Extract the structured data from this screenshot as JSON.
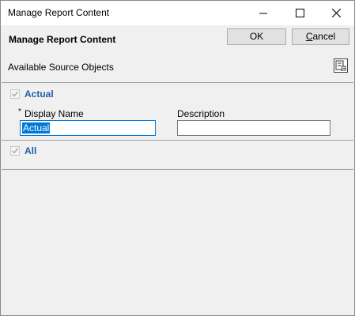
{
  "window": {
    "title": "Manage Report Content",
    "controls": {
      "minimize": "minimize-icon",
      "maximize": "maximize-icon",
      "close": "close-icon"
    }
  },
  "header": {
    "heading": "Manage Report Content",
    "ok_label": "OK",
    "cancel_first": "C",
    "cancel_rest": "ancel"
  },
  "source": {
    "label": "Available Source Objects",
    "tool_icon": "manage-columns-icon"
  },
  "groups": [
    {
      "name": "Actual",
      "checked": true,
      "fields": {
        "display_required_mark": "*",
        "display_label": "Display Name",
        "display_value": "Actual",
        "description_label": "Description",
        "description_value": ""
      }
    },
    {
      "name": "All",
      "checked": true
    }
  ],
  "colors": {
    "accent": "#0078d7",
    "group_text": "#1f5fa6"
  }
}
